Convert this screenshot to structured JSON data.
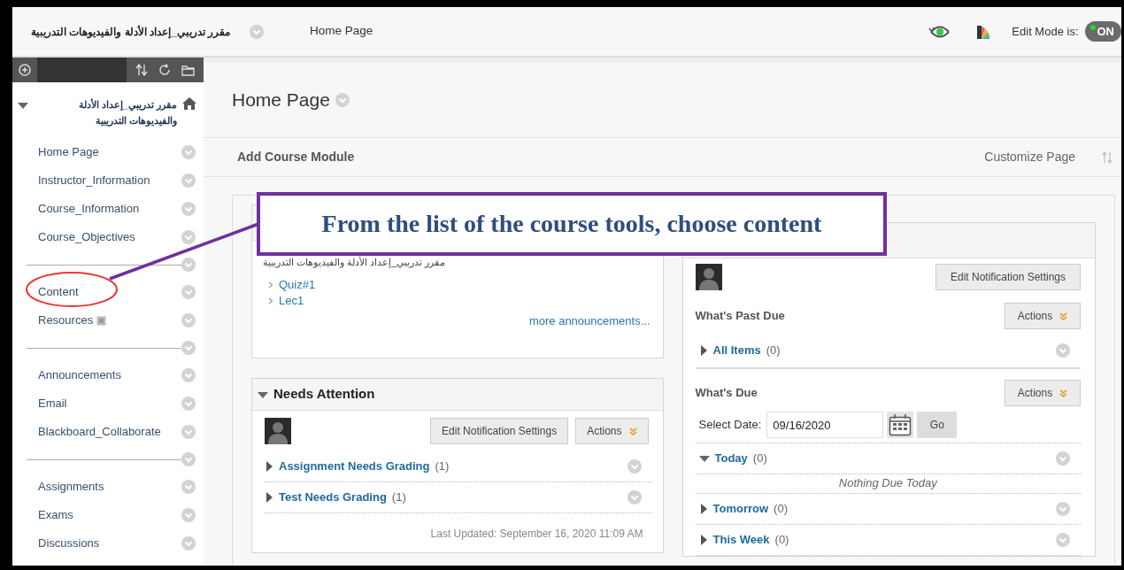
{
  "header": {
    "course_title": "مقرر تدريبي_إعداد الأدلة والفيديوهات التدريبية",
    "page_title": "Home Page",
    "edit_mode_label": "Edit Mode is:",
    "edit_mode_on": true,
    "edit_mode_text": "ON"
  },
  "sidebar": {
    "course_title": "مقرر تدريبي_إعداد الأدلة والفيديوهات التدريبية",
    "expanded": true,
    "groups": [
      {
        "items": [
          {
            "label": "Home Page",
            "kind": "link"
          },
          {
            "label": "Instructor_Information",
            "kind": "link"
          },
          {
            "label": "Course_Information",
            "kind": "link"
          },
          {
            "label": "Course_Objectives",
            "kind": "link"
          }
        ]
      },
      {
        "items": [
          {
            "label": "Content",
            "kind": "link"
          },
          {
            "label": "Resources",
            "kind": "link-with-icon"
          }
        ]
      },
      {
        "items": [
          {
            "label": "Announcements",
            "kind": "link"
          },
          {
            "label": "Email",
            "kind": "link"
          },
          {
            "label": "Blackboard_Collaborate",
            "kind": "link"
          }
        ]
      },
      {
        "items": [
          {
            "label": "Assignments",
            "kind": "link"
          },
          {
            "label": "Exams",
            "kind": "link"
          },
          {
            "label": "Discussions",
            "kind": "link"
          }
        ]
      }
    ]
  },
  "main": {
    "title": "Home Page",
    "add_module": "Add Course Module",
    "customize": "Customize Page"
  },
  "callout": {
    "text": "From the list of the course tools, choose content"
  },
  "announcements": {
    "course_name": "مقرر تدريبي_إعداد الأدلة والفيديوهات التدريبية",
    "items": [
      "Quiz#1",
      "Lec1"
    ],
    "more_link": "more announcements..."
  },
  "needs_attention": {
    "title": "Needs Attention",
    "expanded": true,
    "edit_button": "Edit Notification Settings",
    "actions_button": "Actions",
    "items": [
      {
        "label": "Assignment Needs Grading",
        "count": "(1)",
        "expanded": false
      },
      {
        "label": "Test Needs Grading",
        "count": "(1)",
        "expanded": false
      }
    ],
    "last_updated": "Last Updated: September 16, 2020 11:09 AM"
  },
  "due": {
    "edit_button": "Edit Notification Settings",
    "past_due": {
      "title": "What's Past Due",
      "actions_button": "Actions",
      "items": [
        {
          "label": "All Items",
          "count": "(0)",
          "expanded": false
        }
      ]
    },
    "whats_due": {
      "title": "What's Due",
      "actions_button": "Actions",
      "date_label": "Select Date:",
      "date_value": "09/16/2020",
      "go_button": "Go",
      "items": [
        {
          "label": "Today",
          "count": "(0)",
          "expanded": true,
          "empty_text": "Nothing Due Today"
        },
        {
          "label": "Tomorrow",
          "count": "(0)",
          "expanded": false
        },
        {
          "label": "This Week",
          "count": "(0)",
          "expanded": false
        }
      ]
    }
  }
}
